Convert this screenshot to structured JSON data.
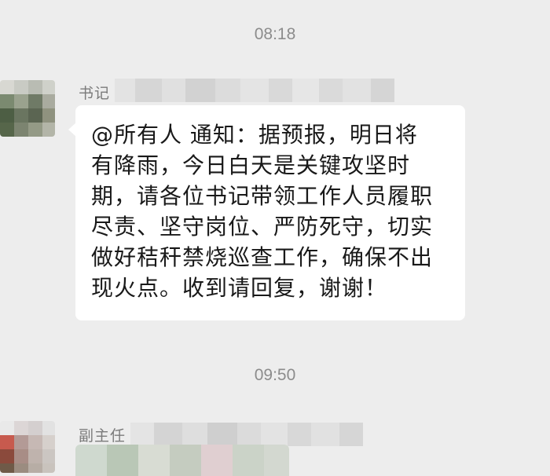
{
  "messages": [
    {
      "timestamp": "08:18",
      "sender": "书记",
      "text_lines": [
        "@所有人  通知：据预报，明日将",
        "有降雨，今日白天是关键攻坚时",
        "期，请各位书记带领工作人员履职",
        "尽责、坚守岗位、严防死守，切实",
        "做好秸秆禁烧巡查工作，确保不出",
        "现火点。收到请回复，谢谢！"
      ]
    },
    {
      "timestamp": "09:50",
      "sender": "副主任"
    }
  ],
  "colors": {
    "background": "#ededed",
    "bubble": "#ffffff",
    "timestamp_text": "#8c8c8c",
    "sender_text": "#7b7b7b",
    "message_text": "#191919"
  }
}
